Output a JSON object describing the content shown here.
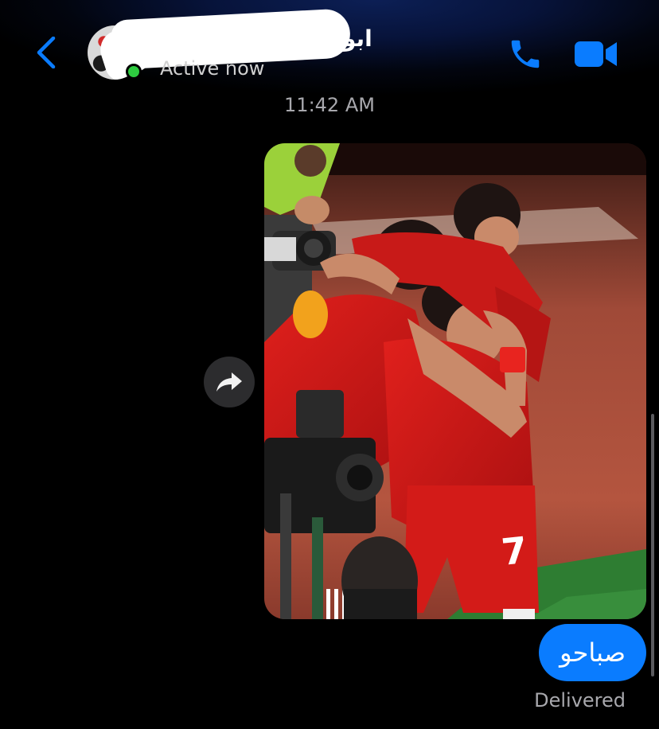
{
  "header": {
    "contact_name": "ابو",
    "status": "Active now",
    "icons": {
      "back": "chevron-left-icon",
      "call": "phone-icon",
      "video": "video-camera-icon",
      "forward": "share-arrow-icon"
    },
    "accent_color": "#0a7cff",
    "online_color": "#2ecc40"
  },
  "thread": {
    "timestamp": "11:42 AM",
    "messages": [
      {
        "type": "image",
        "sender": "me",
        "description_icon": "photo-attachment"
      },
      {
        "type": "text",
        "sender": "me",
        "text": "صباحو"
      }
    ],
    "delivery_status": "Delivered"
  }
}
